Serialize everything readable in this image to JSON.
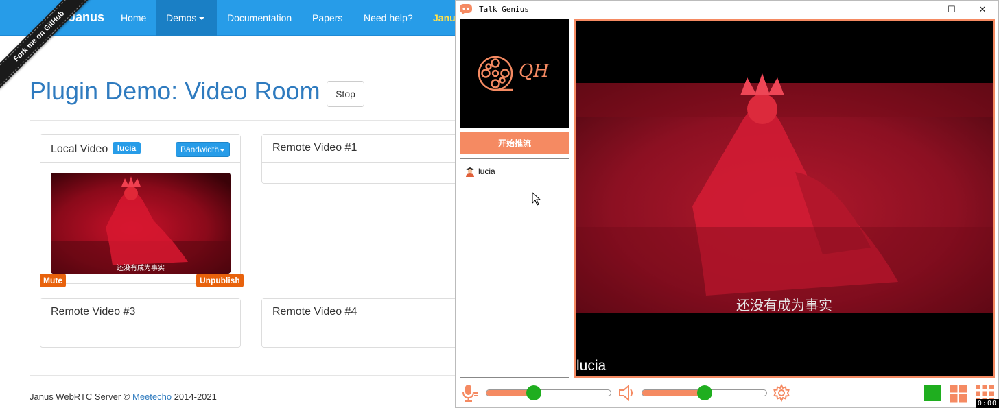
{
  "janus": {
    "brand": "Janus",
    "nav": [
      {
        "label": "Home"
      },
      {
        "label": "Demos"
      },
      {
        "label": "Documentation"
      },
      {
        "label": "Papers"
      },
      {
        "label": "Need help?"
      },
      {
        "label": "Janu"
      }
    ],
    "ribbon": "Fork me on GitHub",
    "page_title": "Plugin Demo: Video Room",
    "stop_label": "Stop",
    "local_panel": {
      "title": "Local Video",
      "user_badge": "lucia",
      "bandwidth_label": "Bandwidth",
      "subtitle": "还没有成为事实",
      "mute_label": "Mute",
      "unpublish_label": "Unpublish"
    },
    "remote_panels": [
      "Remote Video #1",
      "Remote Video #3",
      "Remote Video #4"
    ],
    "footer": {
      "prefix": "Janus WebRTC Server © ",
      "link": "Meetecho",
      "suffix": " 2014-2021"
    }
  },
  "talk_genius": {
    "title": "Talk Genius",
    "window_controls": {
      "minimize": "—",
      "maximize": "☐",
      "close": "✕"
    },
    "logo_text": "QH",
    "push_button": "开始推流",
    "users": [
      {
        "name": "lucia",
        "icon": "user-avatar-icon"
      }
    ],
    "main_video": {
      "user_name": "lucia",
      "subtitle": "还没有成为事实"
    },
    "mic_volume": 0.38,
    "speaker_volume": 0.5,
    "accent_color": "#f58a62",
    "active_color": "#1fae1f"
  },
  "recording_timer": "0:00"
}
